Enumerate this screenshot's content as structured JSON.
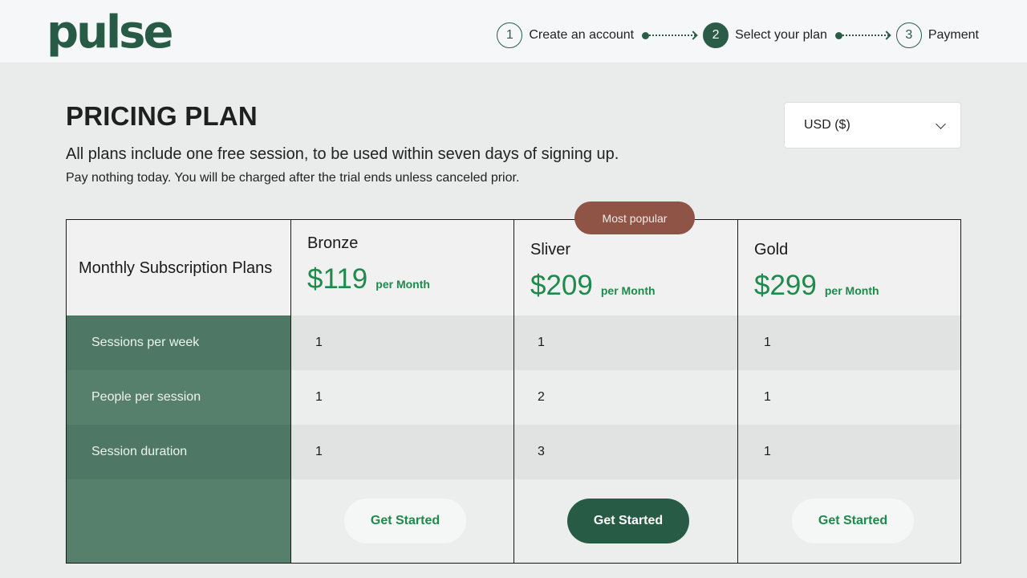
{
  "logo": "pulse",
  "stepper": [
    {
      "num": "1",
      "label": "Create an account",
      "active": false
    },
    {
      "num": "2",
      "label": "Select your plan",
      "active": true
    },
    {
      "num": "3",
      "label": "Payment",
      "active": false
    }
  ],
  "page": {
    "title": "PRICING PLAN",
    "subtitle": "All plans include one free session, to be used within seven days of signing up.",
    "note": "Pay nothing today. You will be charged after the trial ends unless canceled prior."
  },
  "currency": {
    "selected": "USD ($)"
  },
  "table": {
    "header_label": "Monthly Subscription Plans",
    "features": [
      "Sessions per week",
      "People per session",
      "Session duration"
    ],
    "badge": "Most popular",
    "plans": [
      {
        "name": "Bronze",
        "price": "$119",
        "per": "per Month",
        "values": [
          "1",
          "1",
          "1"
        ],
        "cta": "Get Started"
      },
      {
        "name": "Sliver",
        "price": "$209",
        "per": "per Month",
        "values": [
          "1",
          "2",
          "3"
        ],
        "cta": "Get Started"
      },
      {
        "name": "Gold",
        "price": "$299",
        "per": "per Month",
        "values": [
          "1",
          "1",
          "1"
        ],
        "cta": "Get Started"
      }
    ]
  },
  "colors": {
    "brand": "#285b45",
    "price": "#1e8a4b",
    "badge": "#8f5445",
    "feature_column": "#567f6c"
  }
}
